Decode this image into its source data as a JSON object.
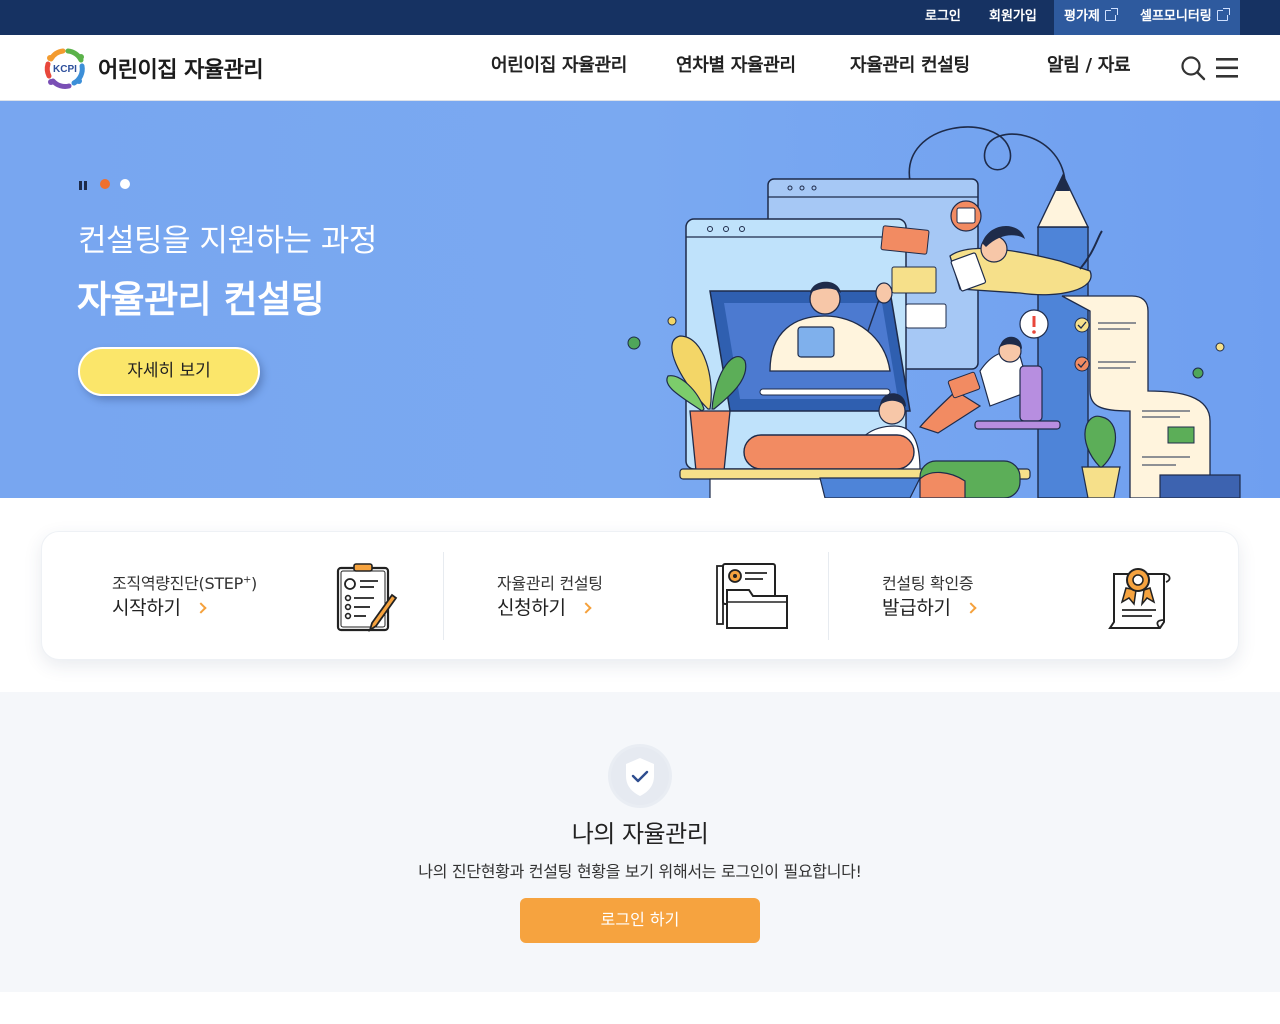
{
  "topbar": {
    "links": [
      {
        "label": "로그인"
      },
      {
        "label": "회원가입"
      },
      {
        "label": "평가제"
      },
      {
        "label": "셀프모니터링"
      }
    ]
  },
  "header": {
    "logo_mark": "KCPI",
    "logo_text": "어린이집 자율관리",
    "nav": [
      {
        "label": "어린이집 자율관리"
      },
      {
        "label": "연차별 자율관리"
      },
      {
        "label": "자율관리 컨설팅"
      },
      {
        "label": "알림 / 자료"
      }
    ],
    "icons": [
      "search-icon",
      "hamburger-menu-icon"
    ]
  },
  "hero": {
    "subtitle": "컨설팅을 지원하는 과정",
    "title": "자율관리 컨설팅",
    "button_label": "자세히 보기",
    "slides": {
      "count": 2,
      "active": 1
    },
    "colors": {
      "background": "#78a6f0",
      "active_dot": "#f0702e",
      "inactive_dot": "#ffffff",
      "button": "#fbe66a"
    }
  },
  "quick_links": [
    {
      "line1": "조직역량진단(STEP",
      "sup": "+",
      "line1_end": ")",
      "line2": "시작하기",
      "icon": "checklist-pen-icon"
    },
    {
      "line1": "자율관리 컨설팅",
      "sup": "",
      "line1_end": "",
      "line2": "신청하기",
      "icon": "folder-document-icon"
    },
    {
      "line1": "컨설팅 확인증",
      "sup": "",
      "line1_end": "",
      "line2": "발급하기",
      "icon": "certificate-icon"
    }
  ],
  "my_section": {
    "title": "나의 자율관리",
    "description": "나의 진단현황과 컨설팅 현황을 보기 위해서는 로그인이 필요합니다!",
    "button_label": "로그인 하기",
    "colors": {
      "button": "#f6a33f"
    }
  }
}
